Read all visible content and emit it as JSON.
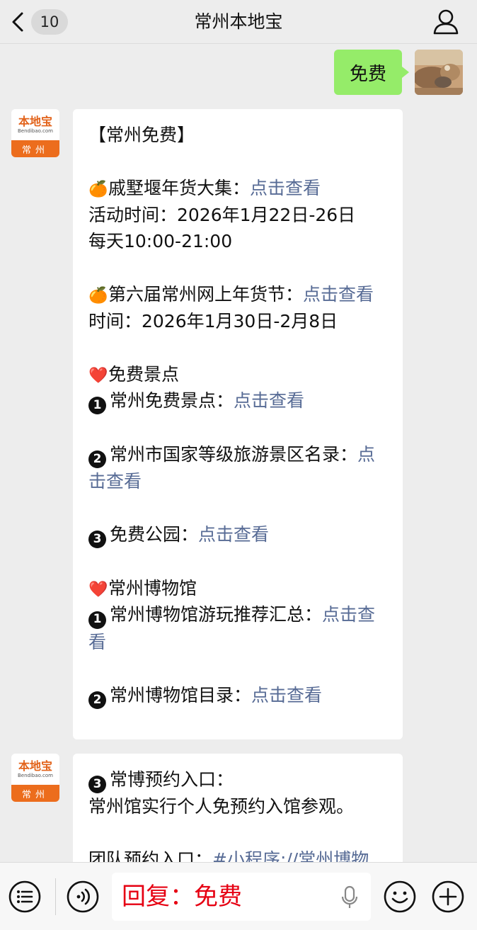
{
  "header": {
    "back_count": "10",
    "title": "常州本地宝"
  },
  "outgoing": {
    "text": "免费"
  },
  "account_avatar": {
    "brand": "本地宝",
    "site": "Bendibao.com",
    "city": "常州"
  },
  "message1": {
    "lines": [
      {
        "text": "【常州免费】"
      },
      {
        "text": ""
      },
      {
        "emoji": "🍊",
        "text": "戚墅堰年货大集：",
        "link": "点击查看"
      },
      {
        "text": "活动时间：2026年1月22日-26日"
      },
      {
        "text": "每天10:00-21:00"
      },
      {
        "text": ""
      },
      {
        "emoji": "🍊",
        "text": "第六届常州网上年货节：",
        "link": "点击查看"
      },
      {
        "text": "时间：2026年1月30日-2月8日"
      },
      {
        "text": ""
      },
      {
        "emoji": "❤️",
        "text": "免费景点"
      },
      {
        "num": "1",
        "text": "常州免费景点：",
        "link": "点击查看"
      },
      {
        "text": ""
      },
      {
        "num": "2",
        "text": "常州市国家等级旅游景区名录：",
        "link": "点击查看"
      },
      {
        "text": ""
      },
      {
        "num": "3",
        "text": "免费公园：",
        "link": "点击查看"
      },
      {
        "text": ""
      },
      {
        "emoji": "❤️",
        "text": "常州博物馆"
      },
      {
        "num": "1",
        "text": "常州博物馆游玩推荐汇总：",
        "link": "点击查看"
      },
      {
        "text": ""
      },
      {
        "num": "2",
        "text": "常州博物馆目录：",
        "link": "点击查看"
      }
    ]
  },
  "message2": {
    "lines": [
      {
        "num": "3",
        "text": "常博预约入口："
      },
      {
        "text": "常州馆实行个人免预约入馆参观。"
      },
      {
        "text": ""
      },
      {
        "text": "团队预约入口：",
        "link": "#小程序://常州博物"
      }
    ]
  },
  "input": {
    "text": "回复：免费"
  },
  "colors": {
    "link": "#576b95",
    "outgoing_bubble": "#95ec69",
    "input_text": "#e60012",
    "brand_orange": "#ec6d1d"
  },
  "icons": [
    "chevron-left-icon",
    "user-icon",
    "menu-list-icon",
    "voice-icon",
    "microphone-icon",
    "emoji-icon",
    "plus-icon"
  ]
}
